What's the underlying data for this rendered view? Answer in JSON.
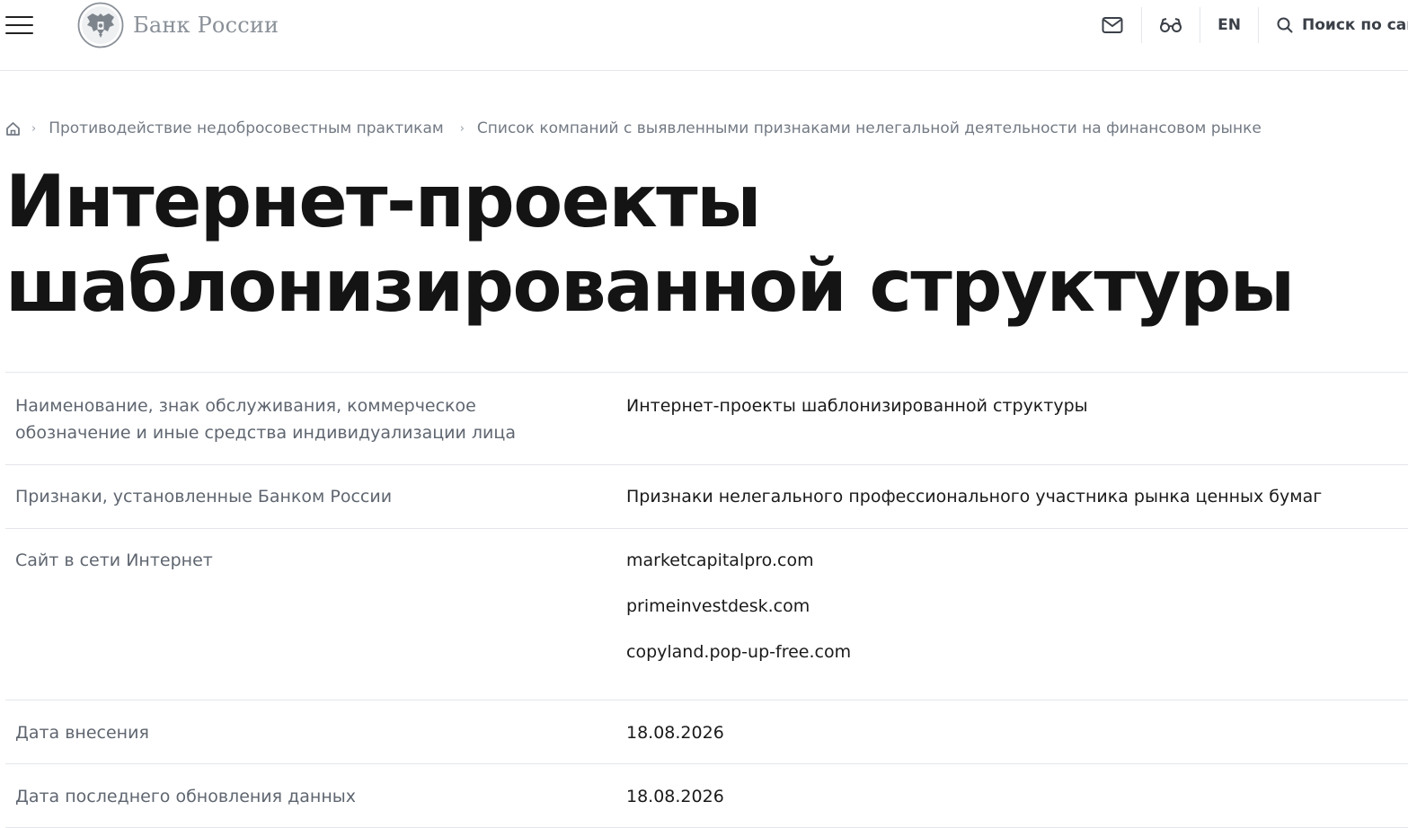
{
  "header": {
    "logo_text": "Банк России",
    "lang_label": "EN",
    "search_label": "Поиск по сайту"
  },
  "breadcrumbs": [
    "Противодействие недобросовестным практикам",
    "Список компаний с выявленными признаками нелегальной деятельности на финансовом рынке"
  ],
  "page": {
    "title": "Интернет-проекты шаблонизированной структуры"
  },
  "details": {
    "name_label": "Наименование, знак обслуживания, коммерческое обозначение и иные средства индивидуализации лица",
    "name_value": "Интернет-проекты шаблонизированной структуры",
    "signs_label": "Признаки, установленные Банком России",
    "signs_value": "Признаки нелегального профессионального участника рынка ценных бумаг",
    "site_label": "Сайт в сети Интернет",
    "sites": [
      "marketcapitalpro.com",
      "primeinvestdesk.com",
      "copyland.pop-up-free.com"
    ],
    "added_label": "Дата внесения",
    "added_value": "18.08.2026",
    "updated_label": "Дата последнего обновления данных",
    "updated_value": "18.08.2026"
  },
  "icons": {
    "menu": "hamburger-icon",
    "emblem": "double-headed-eagle-icon",
    "mail": "mail-icon",
    "accessibility": "glasses-icon",
    "search": "search-icon",
    "home": "home-icon",
    "separator": "chevron-right-icon"
  }
}
